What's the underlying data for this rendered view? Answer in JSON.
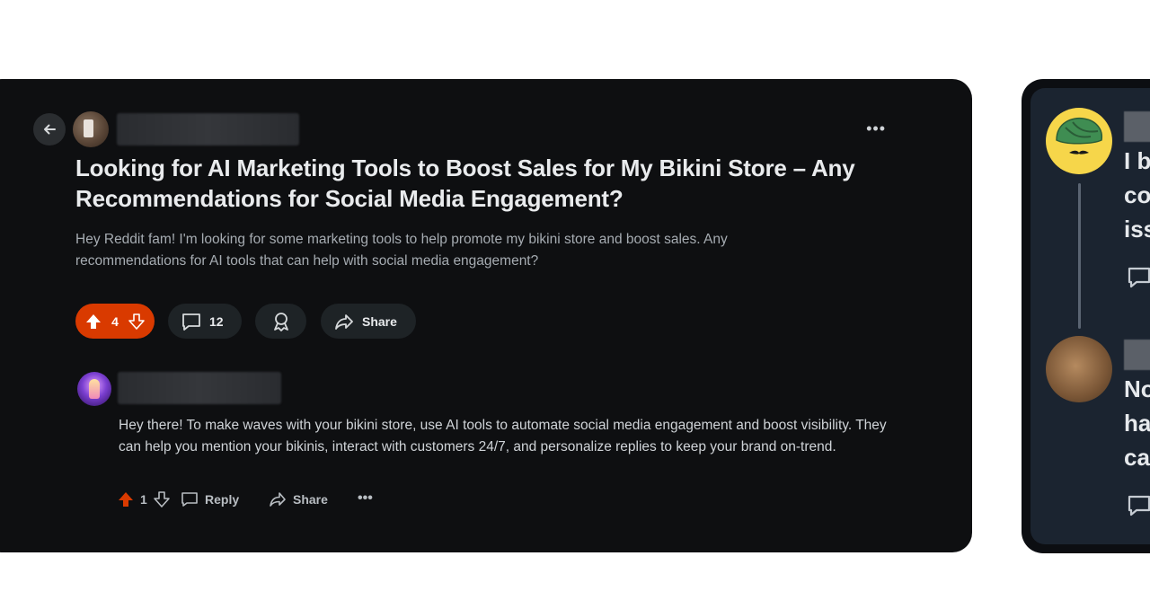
{
  "post": {
    "more_label": "•••",
    "title": "Looking for AI Marketing Tools to Boost Sales for My Bikini Store – Any Recommendations for Social Media Engagement?",
    "body": "Hey Reddit fam! I'm looking for some marketing tools to help promote my bikini store and boost sales. Any recommendations for AI tools that can help with social media engagement?",
    "votes": "4",
    "comments": "12",
    "share_label": "Share"
  },
  "comment": {
    "body": "Hey there! To make waves with your bikini store, use AI tools to automate social media engagement and boost visibility. They can help you mention your bikinis, interact with customers 24/7, and personalize replies to keep your brand on-trend.",
    "votes": "1",
    "reply_label": "Reply",
    "share_label": "Share",
    "more_label": "•••"
  },
  "right_panel": {
    "first_comment_lines": [
      "I b",
      "co",
      "iss"
    ],
    "second_comment_lines": [
      "No",
      "ha",
      "ca"
    ]
  },
  "colors": {
    "card_bg": "#0e0f11",
    "upvote_accent": "#d93a00",
    "right_card_bg": "#1b2430"
  }
}
